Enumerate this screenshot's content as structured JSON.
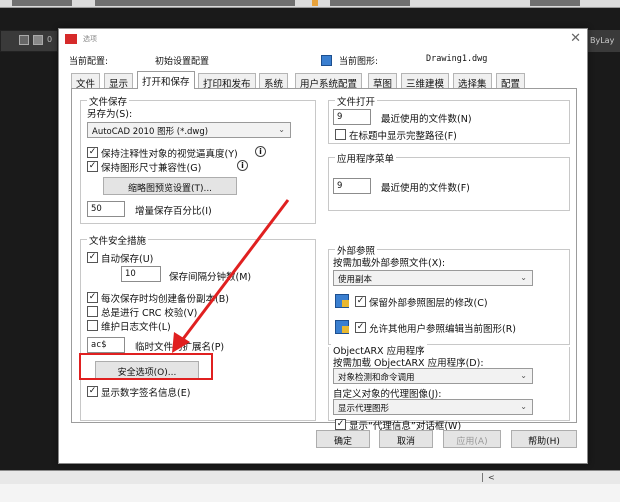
{
  "dialog": {
    "title": "选项",
    "current_profile_label": "当前配置:",
    "current_profile_value": "初始设置配置",
    "current_drawing_label": "当前图形:",
    "current_drawing_value": "Drawing1.dwg"
  },
  "tabs": [
    {
      "label": "文件"
    },
    {
      "label": "显示"
    },
    {
      "label": "打开和保存",
      "active": true
    },
    {
      "label": "打印和发布"
    },
    {
      "label": "系统"
    },
    {
      "label": "用户系统配置"
    },
    {
      "label": "草图"
    },
    {
      "label": "三维建模"
    },
    {
      "label": "选择集"
    },
    {
      "label": "配置"
    }
  ],
  "file_save": {
    "group_label": "文件保存",
    "save_as_label": "另存为(S):",
    "save_as_value": "AutoCAD 2010 图形 (*.dwg)",
    "annot_check_label": "保持注释性对象的视觉逼真度(Y)",
    "drawing_size_check_label": "保持图形尺寸兼容性(G)",
    "thumbnail_btn": "缩略图预览设置(T)...",
    "incremental_value": "50",
    "incremental_label": "增量保存百分比(I)"
  },
  "file_safety": {
    "group_label": "文件安全措施",
    "autosave_label": "自动保存(U)",
    "autosave_minutes": "10",
    "autosave_interval_label": "保存间隔分钟数(M)",
    "backup_label": "每次保存时均创建备份副本(B)",
    "crc_label": "总是进行 CRC 校验(V)",
    "log_label": "维护日志文件(L)",
    "temp_ext_value": "ac$",
    "temp_ext_label": "临时文件的扩展名(P)",
    "security_btn": "安全选项(O)...",
    "digital_sig_label": "显示数字签名信息(E)"
  },
  "file_open": {
    "group_label": "文件打开",
    "recent_files_value": "9",
    "recent_files_label": "最近使用的文件数(N)",
    "full_path_label": "在标题中显示完整路径(F)"
  },
  "app_menu": {
    "group_label": "应用程序菜单",
    "recent_files_value": "9",
    "recent_files_label": "最近使用的文件数(F)"
  },
  "xref": {
    "group_label": "外部参照",
    "demand_load_label": "按需加载外部参照文件(X):",
    "demand_load_value": "使用副本",
    "retain_changes_label": "保留外部参照图层的修改(C)",
    "allow_edit_label": "允许其他用户参照编辑当前图形(R)"
  },
  "objectarx": {
    "group_label": "ObjectARX 应用程序",
    "load_label": "按需加载 ObjectARX 应用程序(D):",
    "load_value": "对象检测和命令调用",
    "proxy_label": "自定义对象的代理图像(J):",
    "proxy_value": "显示代理图形",
    "proxy_info_label": "显示“代理信息”对话框(W)"
  },
  "buttons": {
    "ok": "确定",
    "cancel": "取消",
    "apply": "应用(A)",
    "help": "帮助(H)"
  },
  "background": {
    "left_tab_text": "0",
    "right_tab_text": "ByLay"
  },
  "colors": {
    "accent_red": "#e02020",
    "dialog_bg": "#ffffff"
  }
}
